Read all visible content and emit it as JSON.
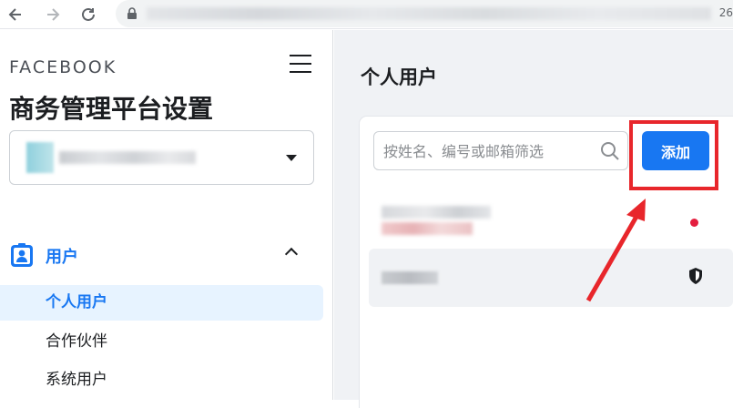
{
  "browser": {
    "url_tail": "26"
  },
  "sidebar": {
    "brand": "FACEBOOK",
    "heading": "商务管理平台设置",
    "section": {
      "label": "用户"
    },
    "items": [
      {
        "label": "个人用户"
      },
      {
        "label": "合作伙伴"
      },
      {
        "label": "系统用户"
      }
    ]
  },
  "main": {
    "title": "个人用户",
    "search": {
      "placeholder": "按姓名、编号或邮箱筛选"
    },
    "add_button": "添加"
  },
  "colors": {
    "accent": "#1877f2",
    "highlight": "#e8262b",
    "alert_dot": "#e41e3f"
  }
}
